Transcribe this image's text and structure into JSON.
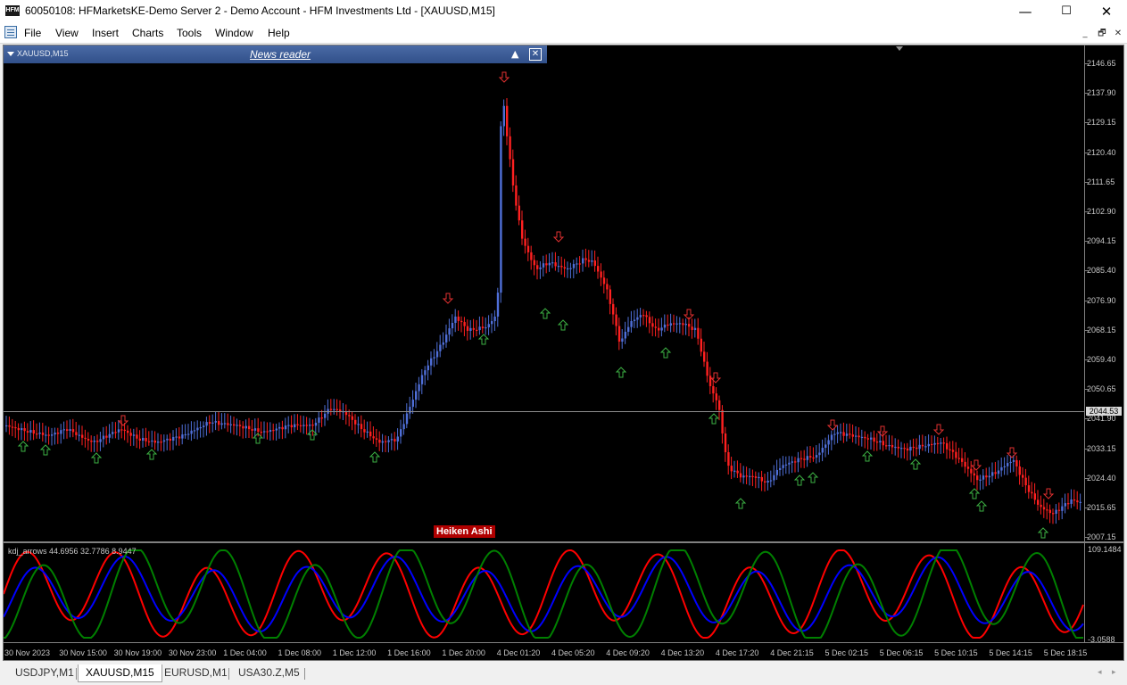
{
  "window": {
    "title": "60050108: HFMarketsKE-Demo Server 2 - Demo Account - HFM Investments Ltd - [XAUUSD,M15]",
    "minimize": "—",
    "maximize": "☐",
    "close": "✕"
  },
  "menu": {
    "items": [
      "File",
      "View",
      "Insert",
      "Charts",
      "Tools",
      "Window",
      "Help"
    ],
    "mdi_minimize": "_",
    "mdi_restore": "🗗",
    "mdi_close": "✕"
  },
  "chart": {
    "symbol_label": "XAUUSD,M15",
    "news_reader": "News reader",
    "news_up": "▲",
    "news_close": "✕",
    "price_ticks": [
      "2146.65",
      "2137.90",
      "2129.15",
      "2120.40",
      "2111.65",
      "2102.90",
      "2094.15",
      "2085.40",
      "2076.90",
      "2068.15",
      "2059.40",
      "2050.65",
      "2041.90",
      "2033.15",
      "2024.40",
      "2015.65",
      "2007.15"
    ],
    "current_price": "2044.53",
    "heiken_label": "Heiken Ashi",
    "indicator_label": "kdj_arrows 44.6956 32.7786 8.9447",
    "indicator_ticks": [
      "109.1484",
      "-3.0588"
    ],
    "indicator_colors": {
      "k": "#ff0000",
      "d": "#0000ff",
      "j": "#008000"
    },
    "candle_colors": {
      "up": "#4f6fd8",
      "down": "#ff2020"
    },
    "time_ticks": [
      "30 Nov 2023",
      "30 Nov 15:00",
      "30 Nov 19:00",
      "30 Nov 23:00",
      "1 Dec 04:00",
      "1 Dec 08:00",
      "1 Dec 12:00",
      "1 Dec 16:00",
      "1 Dec 20:00",
      "4 Dec 01:20",
      "4 Dec 05:20",
      "4 Dec 09:20",
      "4 Dec 13:20",
      "4 Dec 17:20",
      "4 Dec 21:15",
      "5 Dec 02:15",
      "5 Dec 06:15",
      "5 Dec 10:15",
      "5 Dec 14:15",
      "5 Dec 18:15"
    ]
  },
  "tabs": [
    "USDJPY,M1",
    "XAUUSD,M15",
    "EURUSD,M1",
    "USA30.Z,M5"
  ],
  "active_tab": "XAUUSD,M15"
}
